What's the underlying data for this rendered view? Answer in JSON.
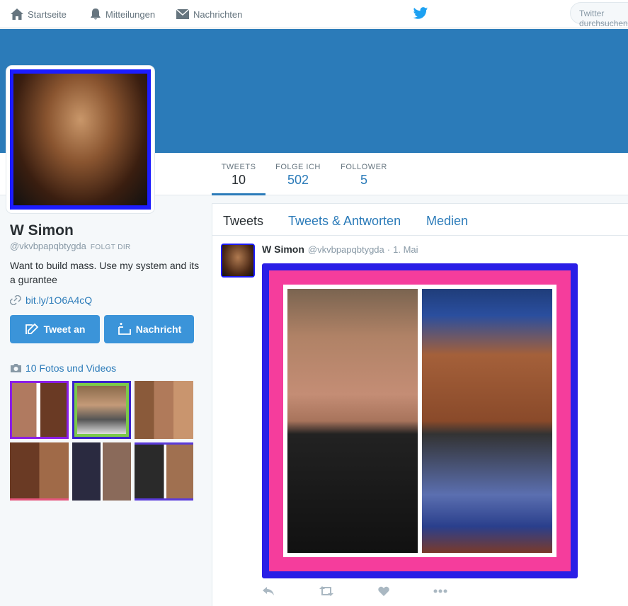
{
  "nav": {
    "home": "Startseite",
    "notifications": "Mitteilungen",
    "messages": "Nachrichten",
    "search_placeholder": "Twitter durchsuchen"
  },
  "stats": {
    "tweets_label": "TWEETS",
    "tweets_value": "10",
    "following_label": "FOLGE ICH",
    "following_value": "502",
    "followers_label": "FOLLOWER",
    "followers_value": "5"
  },
  "profile": {
    "name": "W Simon",
    "handle": "@vkvbpapqbtygda",
    "follows_you": "FOLGT DIR",
    "bio": "Want to build mass. Use my system and its a gurantee",
    "link": "bit.ly/1O6A4cQ",
    "tweet_button": "Tweet an",
    "message_button": "Nachricht",
    "photos_label": "10 Fotos und Videos"
  },
  "tabs": {
    "tweets": "Tweets",
    "replies": "Tweets & Antworten",
    "media": "Medien"
  },
  "tweet": {
    "name": "W Simon",
    "handle": "@vkvbpapqbtygda",
    "separator": "·",
    "time": "1. Mai"
  },
  "colors": {
    "accent": "#2b7bb9",
    "button": "#3b94d9",
    "media_frame_outer": "#2a1ee6",
    "media_frame_inner": "#f53d9c"
  }
}
